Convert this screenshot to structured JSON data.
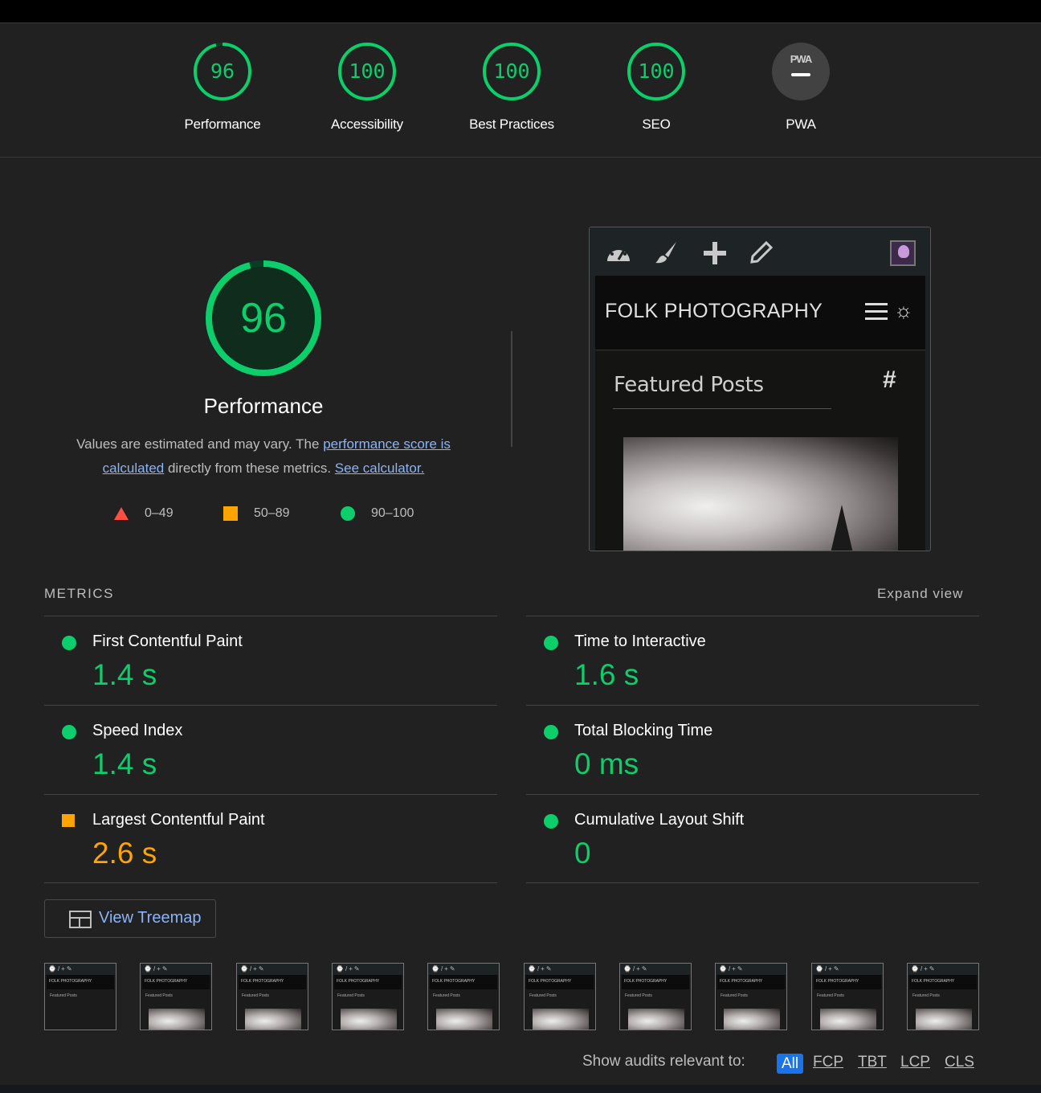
{
  "categories": [
    {
      "score": "96",
      "label": "Performance",
      "fraction": 0.96
    },
    {
      "score": "100",
      "label": "Accessibility",
      "fraction": 1.0
    },
    {
      "score": "100",
      "label": "Best Practices",
      "fraction": 1.0
    },
    {
      "score": "100",
      "label": "SEO",
      "fraction": 1.0
    },
    {
      "label": "PWA",
      "badge": "PWA"
    }
  ],
  "performance": {
    "score": "96",
    "fraction": 0.96,
    "title": "Performance",
    "desc_1": "Values are estimated and may vary. The ",
    "desc_link1": "performance score is calculated",
    "desc_2": " directly from these metrics. ",
    "desc_link2": "See calculator.",
    "legend": [
      "0–49",
      "50–89",
      "90–100"
    ]
  },
  "screenshot": {
    "site_title": "FOLK PHOTOGRAPHY",
    "featured": "Featured Posts"
  },
  "metrics": {
    "title": "METRICS",
    "expand": "Expand view",
    "items": [
      {
        "name": "First Contentful Paint",
        "value": "1.4 s",
        "status": "pass"
      },
      {
        "name": "Time to Interactive",
        "value": "1.6 s",
        "status": "pass"
      },
      {
        "name": "Speed Index",
        "value": "1.4 s",
        "status": "pass"
      },
      {
        "name": "Total Blocking Time",
        "value": "0 ms",
        "status": "pass"
      },
      {
        "name": "Largest Contentful Paint",
        "value": "2.6 s",
        "status": "average"
      },
      {
        "name": "Cumulative Layout Shift",
        "value": "0",
        "status": "pass"
      }
    ]
  },
  "treemap_label": "View Treemap",
  "thumbnails": {
    "site_title": "FOLK PHOTOGRAPHY",
    "featured": "Featured Posts"
  },
  "filter": {
    "label": "Show audits relevant to:",
    "options": [
      "All",
      "FCP",
      "TBT",
      "LCP",
      "CLS"
    ]
  },
  "colors": {
    "pass": "#0cce6b",
    "average": "#ffa400",
    "fail": "#ff4e42",
    "link": "#8ab4f8"
  }
}
